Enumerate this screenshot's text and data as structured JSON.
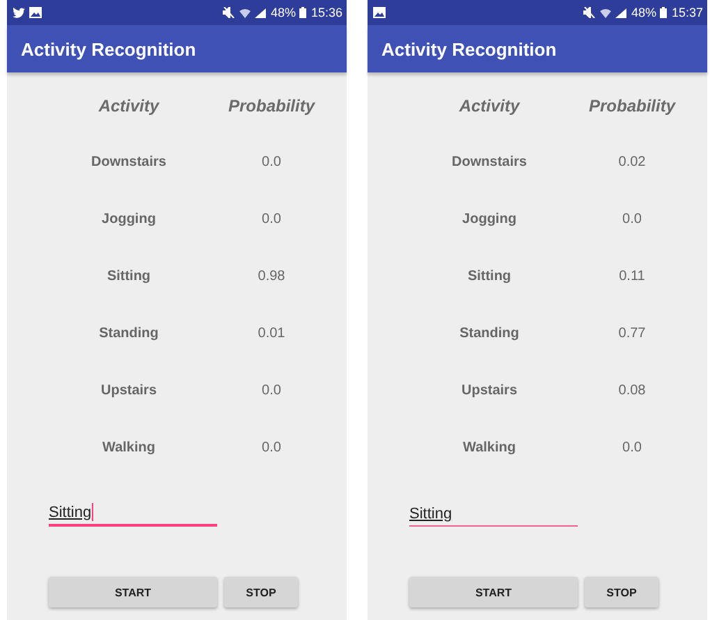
{
  "screens": [
    {
      "status_bar": {
        "notifications": [
          {
            "kind": "bird"
          },
          {
            "kind": "image"
          }
        ],
        "battery": "48%",
        "time": "15:36"
      },
      "app_bar": {
        "title": "Activity Recognition"
      },
      "table": {
        "columns": [
          "Activity",
          "Probability"
        ],
        "rows": [
          {
            "activity": "Downstairs",
            "probability": "0.0"
          },
          {
            "activity": "Jogging",
            "probability": "0.0"
          },
          {
            "activity": "Sitting",
            "probability": "0.98"
          },
          {
            "activity": "Standing",
            "probability": "0.01"
          },
          {
            "activity": "Upstairs",
            "probability": "0.0"
          },
          {
            "activity": "Walking",
            "probability": "0.0"
          }
        ]
      },
      "field": {
        "value": "Sitting",
        "focused": true
      },
      "buttons": [
        "START",
        "STOP"
      ]
    },
    {
      "status_bar": {
        "notifications": [
          {
            "kind": "image"
          }
        ],
        "battery": "48%",
        "time": "15:37"
      },
      "app_bar": {
        "title": "Activity Recognition"
      },
      "table": {
        "columns": [
          "Activity",
          "Probability"
        ],
        "rows": [
          {
            "activity": "Downstairs",
            "probability": "0.02"
          },
          {
            "activity": "Jogging",
            "probability": "0.0"
          },
          {
            "activity": "Sitting",
            "probability": "0.11"
          },
          {
            "activity": "Standing",
            "probability": "0.77"
          },
          {
            "activity": "Upstairs",
            "probability": "0.08"
          },
          {
            "activity": "Walking",
            "probability": "0.0"
          }
        ]
      },
      "field": {
        "value": "Sitting",
        "focused": false
      },
      "buttons": [
        "START",
        "STOP"
      ]
    }
  ]
}
